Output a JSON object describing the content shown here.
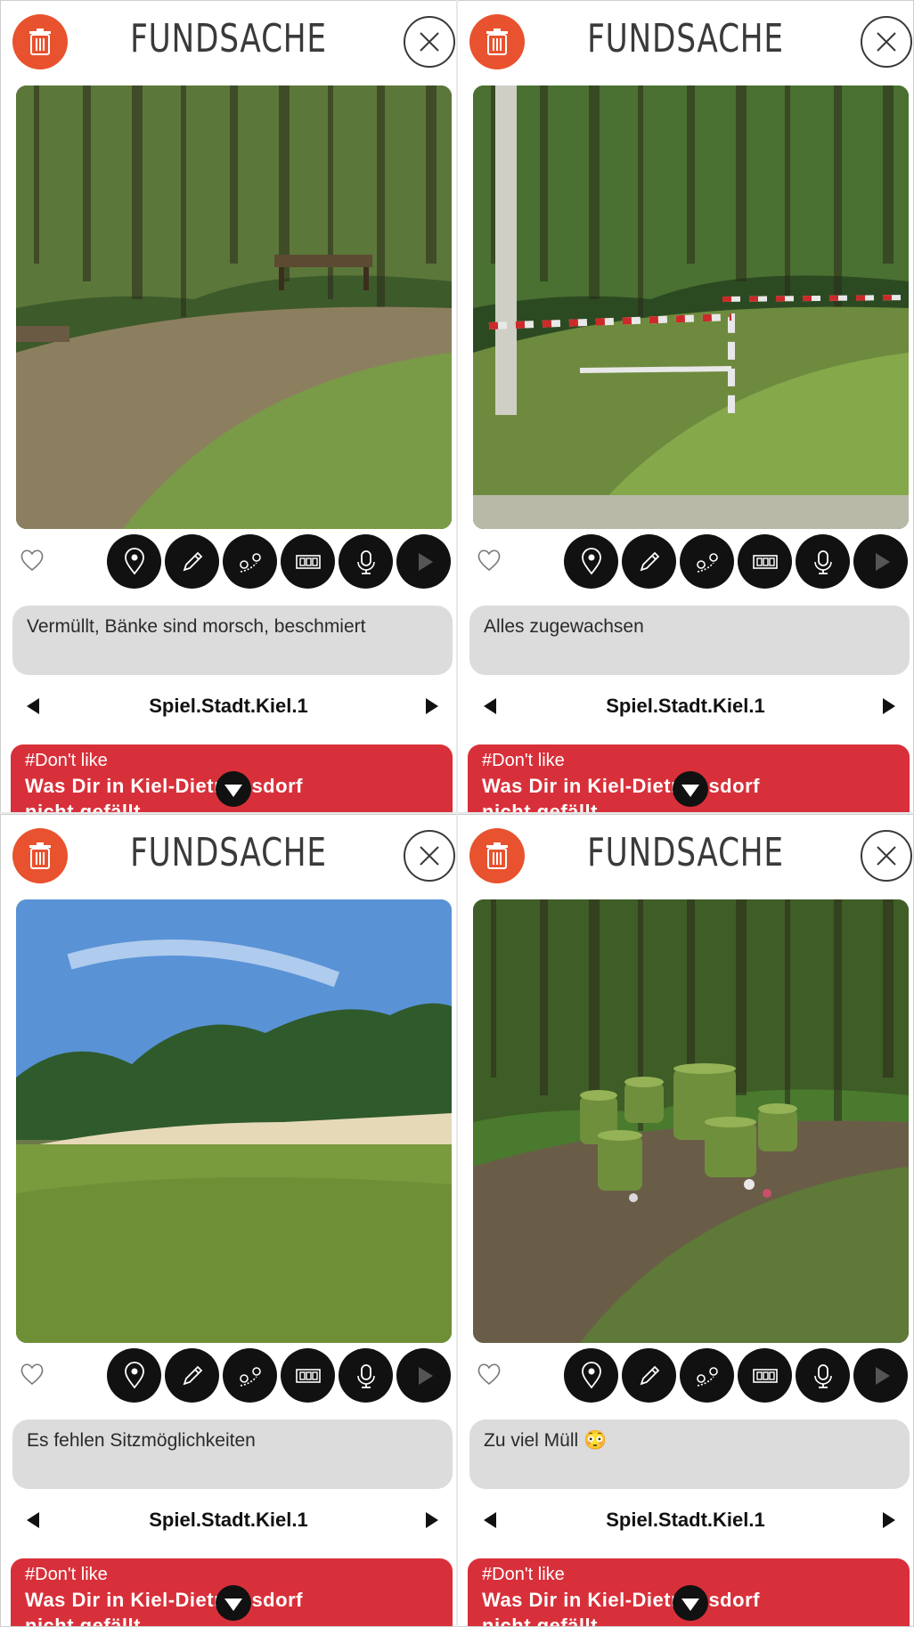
{
  "panels": [
    {
      "title": "FUNDSACHE",
      "comment": "Vermüllt, Bänke sind morsch, beschmiert",
      "pager_label": "Spiel.Stadt.Kiel.1",
      "category_tag": "#Don't like",
      "category_question": "Was Dir in Kiel-Dietrichsdorf",
      "category_question_cont": "nicht gefällt",
      "photo_scene": "shaded park path with wooden benches",
      "photo_colors": {
        "sky": "#3d5a2a",
        "mid": "#5f7a3c",
        "ground": "#8c7f60",
        "grass": "#76a043"
      }
    },
    {
      "title": "FUNDSACHE",
      "comment": "Alles zugewachsen",
      "pager_label": "Spiel.Stadt.Kiel.1",
      "category_tag": "#Don't like",
      "category_question": "Was Dir in Kiel-Dietrichsdorf",
      "category_question_cont": "nicht gefällt",
      "photo_scene": "overgrown path with red-white barrier",
      "photo_colors": {
        "sky": "#2c4a22",
        "mid": "#4e7434",
        "ground": "#6e8a3e",
        "grass": "#89ad4d"
      }
    },
    {
      "title": "FUNDSACHE",
      "comment": "Es fehlen Sitzmöglichkeiten",
      "pager_label": "Spiel.Stadt.Kiel.1",
      "category_tag": "#Don't like",
      "category_question": "Was Dir in Kiel-Dietrichsdorf",
      "category_question_cont": "nicht gefällt",
      "photo_scene": "meadow with sandy beach and blue sky",
      "photo_colors": {
        "sky": "#5a92d6",
        "mid": "#2f5a2c",
        "ground": "#e6d9b8",
        "grass": "#7a9a3e"
      }
    },
    {
      "title": "FUNDSACHE",
      "comment": "Zu viel Müll 😳",
      "pager_label": "Spiel.Stadt.Kiel.1",
      "category_tag": "#Don't like",
      "category_question": "Was Dir in Kiel-Dietrichsdorf",
      "category_question_cont": "nicht gefällt",
      "photo_scene": "wooded area with green posts and litter",
      "photo_colors": {
        "sky": "#4a7a2e",
        "mid": "#3e5a26",
        "ground": "#6a5d48",
        "grass": "#5c7e36"
      }
    }
  ],
  "icons": {
    "trash": "trash-icon",
    "close": "close-icon",
    "heart": "heart-icon",
    "tools": [
      "map-pin-icon",
      "pencil-icon",
      "route-icon",
      "film-icon",
      "microphone-icon",
      "play-icon"
    ]
  },
  "colors": {
    "trash_bg": "#e8522e",
    "category_bg": "#d8303a",
    "comment_bg": "#dcdcdc",
    "tool_bg": "#111111"
  }
}
